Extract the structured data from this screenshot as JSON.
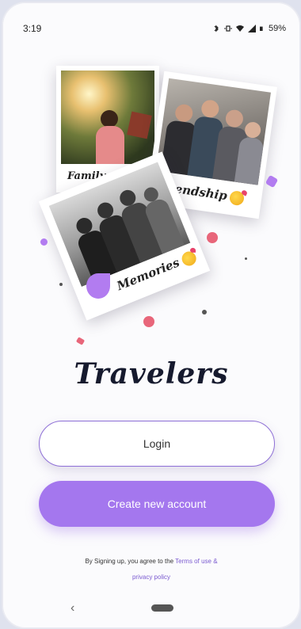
{
  "status_bar": {
    "time": "3:19",
    "battery": "59%",
    "icons": [
      "bluetooth-icon",
      "vibrate-icon",
      "wifi-icon",
      "signal-icon",
      "battery-icon"
    ]
  },
  "photos": [
    {
      "caption": "Family",
      "icon": "photo-person-sunlight"
    },
    {
      "caption": "Friendship",
      "icon": "photo-friends-group"
    },
    {
      "caption": "Memories",
      "icon": "photo-bw-group"
    }
  ],
  "app": {
    "title": "Travelers"
  },
  "buttons": {
    "login": "Login",
    "create": "Create new account"
  },
  "terms": {
    "prefix": "By Signing up, you agree to the",
    "terms_link": "Terms of use &",
    "privacy_link": "privacy policy"
  },
  "nav": {
    "back": "‹"
  },
  "colors": {
    "accent": "#a477ee",
    "title": "#161a2e",
    "link": "#7a5ad0"
  }
}
